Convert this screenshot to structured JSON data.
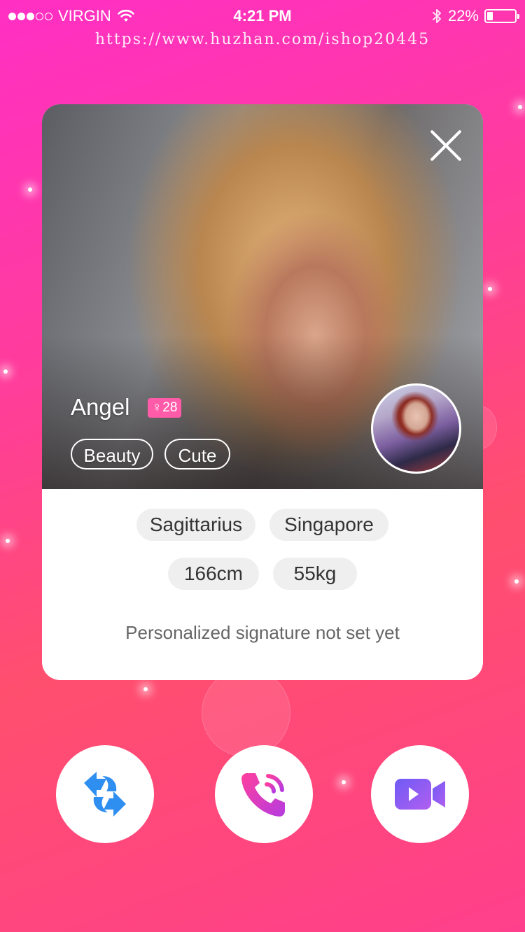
{
  "status_bar": {
    "carrier": "VIRGIN",
    "time": "4:21 PM",
    "battery": "22%",
    "battery_level": 0.22
  },
  "watermark": "https://www.huzhan.com/ishop20445",
  "profile": {
    "name": "Angel",
    "gender_symbol": "♀",
    "age": "28",
    "tags": [
      "Beauty",
      "Cute"
    ],
    "info_row1": [
      "Sagittarius",
      "Singapore"
    ],
    "info_row2": [
      "166cm",
      "55kg"
    ],
    "signature": "Personalized signature not set yet"
  },
  "icons": {
    "close": "close-icon",
    "swap": "refresh-arrows-icon",
    "call": "phone-call-icon",
    "video": "video-camera-icon"
  },
  "colors": {
    "background_top": "#ff2fc4",
    "background_mid": "#ff4f6e",
    "badge": "#ff5ba9",
    "swap_icon": "#2f8ff0",
    "call_icon": "#d43bd0",
    "video_icon": "#8a55f5"
  }
}
